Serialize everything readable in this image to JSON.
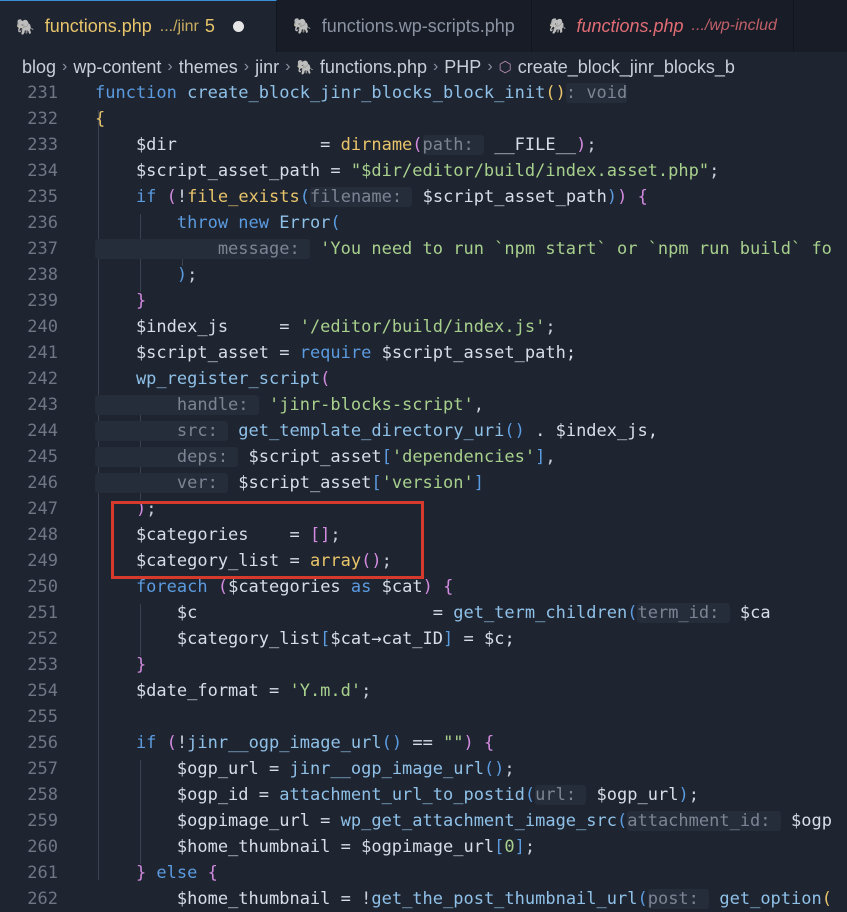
{
  "tabs": [
    {
      "name": "functions.php",
      "dir": ".../jinr",
      "count": "5",
      "active": true,
      "modified": true
    },
    {
      "name": "functions.wp-scripts.php",
      "active": false
    },
    {
      "name": "functions.php",
      "dir": ".../wp-includ",
      "active": false,
      "error": true
    }
  ],
  "breadcrumb": [
    "blog",
    "wp-content",
    "themes",
    "jinr",
    "functions.php",
    "PHP",
    "create_block_jinr_blocks_b"
  ],
  "lines": [
    {
      "n": "231",
      "t": [
        [
          "k",
          "function "
        ],
        [
          "f",
          "create_block_jinr_blocks_block_init"
        ],
        [
          "b1",
          "()"
        ],
        [
          "h",
          ": void"
        ]
      ]
    },
    {
      "n": "232",
      "t": [
        [
          "b1",
          "{"
        ]
      ]
    },
    {
      "n": "233",
      "t": [
        [
          "v",
          "    $dir              = "
        ],
        [
          "fn",
          "dirname"
        ],
        [
          "b2",
          "("
        ],
        [
          "h",
          "path: "
        ],
        [
          "v",
          " __FILE__"
        ],
        [
          "b2",
          ")"
        ],
        [
          "p",
          ";"
        ]
      ]
    },
    {
      "n": "234",
      "t": [
        [
          "v",
          "    $script_asset_path = "
        ],
        [
          "s",
          "\"$dir/editor/build/index.asset.php\""
        ],
        [
          "p",
          ";"
        ]
      ]
    },
    {
      "n": "235",
      "t": [
        [
          "k",
          "    if "
        ],
        [
          "b2",
          "("
        ],
        [
          "p",
          "!"
        ],
        [
          "fn",
          "file_exists"
        ],
        [
          "b3",
          "("
        ],
        [
          "h",
          "filename: "
        ],
        [
          "v",
          " $script_asset_path"
        ],
        [
          "b3",
          ")"
        ],
        [
          "b2",
          ")"
        ],
        [
          "p",
          " "
        ],
        [
          "b2",
          "{"
        ]
      ]
    },
    {
      "n": "236",
      "t": [
        [
          "k",
          "        throw new "
        ],
        [
          "f",
          "Error"
        ],
        [
          "b3",
          "("
        ]
      ]
    },
    {
      "n": "237",
      "t": [
        [
          "h",
          "            message: "
        ],
        [
          "s",
          " 'You need to run `npm start` or `npm run build` fo"
        ]
      ]
    },
    {
      "n": "238",
      "t": [
        [
          "b3",
          "        )"
        ],
        [
          "p",
          ";"
        ]
      ]
    },
    {
      "n": "239",
      "t": [
        [
          "b2",
          "    }"
        ]
      ]
    },
    {
      "n": "240",
      "t": [
        [
          "v",
          "    $index_js     = "
        ],
        [
          "s",
          "'/editor/build/index.js'"
        ],
        [
          "p",
          ";"
        ]
      ]
    },
    {
      "n": "241",
      "t": [
        [
          "v",
          "    $script_asset = "
        ],
        [
          "k",
          "require"
        ],
        [
          "v",
          " $script_asset_path;"
        ]
      ]
    },
    {
      "n": "242",
      "t": [
        [
          "f",
          "    wp_register_script"
        ],
        [
          "b2",
          "("
        ]
      ]
    },
    {
      "n": "243",
      "t": [
        [
          "h",
          "        handle: "
        ],
        [
          "s",
          " 'jinr-blocks-script'"
        ],
        [
          "p",
          ","
        ]
      ]
    },
    {
      "n": "244",
      "t": [
        [
          "h",
          "        src: "
        ],
        [
          "f",
          " get_template_directory_uri"
        ],
        [
          "b3",
          "()"
        ],
        [
          "v",
          " . $index_js,"
        ]
      ]
    },
    {
      "n": "245",
      "t": [
        [
          "h",
          "        deps: "
        ],
        [
          "v",
          " $script_asset"
        ],
        [
          "b3",
          "["
        ],
        [
          "s",
          "'dependencies'"
        ],
        [
          "b3",
          "]"
        ],
        [
          "p",
          ","
        ]
      ]
    },
    {
      "n": "246",
      "t": [
        [
          "h",
          "        ver: "
        ],
        [
          "v",
          " $script_asset"
        ],
        [
          "b3",
          "["
        ],
        [
          "s",
          "'version'"
        ],
        [
          "b3",
          "]"
        ]
      ]
    },
    {
      "n": "247",
      "t": [
        [
          "b2",
          "    )"
        ],
        [
          "p",
          ";"
        ]
      ]
    },
    {
      "n": "248",
      "t": [
        [
          "v",
          "    $categories    = "
        ],
        [
          "b2",
          "[]"
        ],
        [
          "p",
          ";"
        ]
      ]
    },
    {
      "n": "249",
      "t": [
        [
          "v",
          "    $category_list = "
        ],
        [
          "fn",
          "array"
        ],
        [
          "b2",
          "()"
        ],
        [
          "p",
          ";"
        ]
      ]
    },
    {
      "n": "250",
      "t": [
        [
          "k",
          "    foreach "
        ],
        [
          "b2",
          "("
        ],
        [
          "v",
          "$categories "
        ],
        [
          "k",
          "as"
        ],
        [
          "v",
          " $cat"
        ],
        [
          "b2",
          ")"
        ],
        [
          "p",
          " "
        ],
        [
          "b2",
          "{"
        ]
      ]
    },
    {
      "n": "251",
      "t": [
        [
          "v",
          "        $c                       = "
        ],
        [
          "f",
          "get_term_children"
        ],
        [
          "b3",
          "("
        ],
        [
          "h",
          "term_id: "
        ],
        [
          "v",
          " $ca"
        ]
      ]
    },
    {
      "n": "252",
      "t": [
        [
          "v",
          "        $category_list"
        ],
        [
          "b3",
          "["
        ],
        [
          "v",
          "$cat→cat_ID"
        ],
        [
          "b3",
          "]"
        ],
        [
          "v",
          " = $c;"
        ]
      ]
    },
    {
      "n": "253",
      "t": [
        [
          "b2",
          "    }"
        ]
      ]
    },
    {
      "n": "254",
      "t": [
        [
          "v",
          "    $date_format = "
        ],
        [
          "s",
          "'Y.m.d'"
        ],
        [
          "p",
          ";"
        ]
      ]
    },
    {
      "n": "255",
      "t": []
    },
    {
      "n": "256",
      "t": [
        [
          "k",
          "    if "
        ],
        [
          "b2",
          "("
        ],
        [
          "p",
          "!"
        ],
        [
          "f",
          "jinr__ogp_image_url"
        ],
        [
          "b3",
          "()"
        ],
        [
          "v",
          " == "
        ],
        [
          "s",
          "\"\""
        ],
        [
          "b2",
          ")"
        ],
        [
          "p",
          " "
        ],
        [
          "b2",
          "{"
        ]
      ]
    },
    {
      "n": "257",
      "t": [
        [
          "v",
          "        $ogp_url = "
        ],
        [
          "f",
          "jinr__ogp_image_url"
        ],
        [
          "b3",
          "()"
        ],
        [
          "p",
          ";"
        ]
      ]
    },
    {
      "n": "258",
      "t": [
        [
          "v",
          "        $ogp_id = "
        ],
        [
          "f",
          "attachment_url_to_postid"
        ],
        [
          "b3",
          "("
        ],
        [
          "h",
          "url: "
        ],
        [
          "v",
          " $ogp_url"
        ],
        [
          "b3",
          ")"
        ],
        [
          "p",
          ";"
        ]
      ]
    },
    {
      "n": "259",
      "t": [
        [
          "v",
          "        $ogpimage_url = "
        ],
        [
          "f",
          "wp_get_attachment_image_src"
        ],
        [
          "b3",
          "("
        ],
        [
          "h",
          "attachment_id: "
        ],
        [
          "v",
          " $ogp"
        ]
      ]
    },
    {
      "n": "260",
      "t": [
        [
          "v",
          "        $home_thumbnail = $ogpimage_url"
        ],
        [
          "b3",
          "["
        ],
        [
          "s",
          "0"
        ],
        [
          "b3",
          "]"
        ],
        [
          "p",
          ";"
        ]
      ]
    },
    {
      "n": "261",
      "t": [
        [
          "b2",
          "    }"
        ],
        [
          "k",
          " else "
        ],
        [
          "b2",
          "{"
        ]
      ]
    },
    {
      "n": "262",
      "t": [
        [
          "v",
          "        $home_thumbnail = "
        ],
        [
          "p",
          "!"
        ],
        [
          "f",
          "get_the_post_thumbnail_url"
        ],
        [
          "b3",
          "("
        ],
        [
          "h",
          "post: "
        ],
        [
          "f",
          " get_option"
        ],
        [
          "b1",
          "("
        ]
      ]
    }
  ]
}
